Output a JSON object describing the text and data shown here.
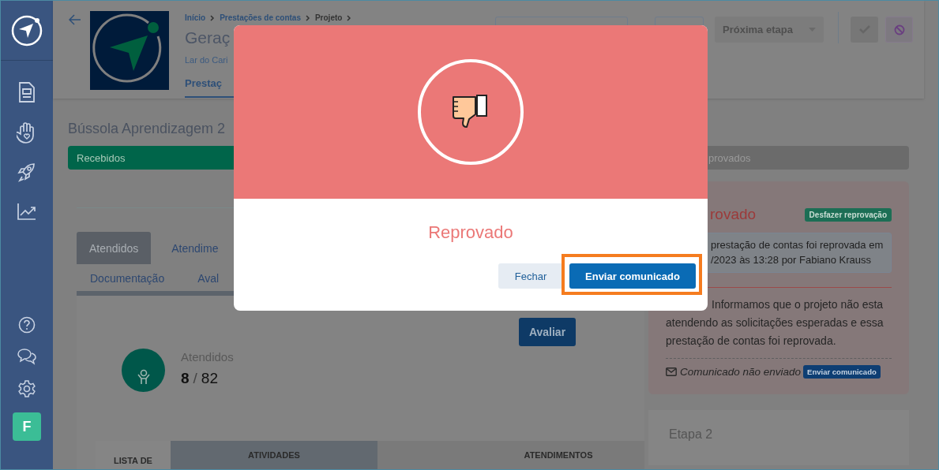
{
  "sidebar": {
    "avatar": "F"
  },
  "header": {
    "breadcrumb": [
      "Início",
      "Prestações de contas",
      "Projeto"
    ],
    "title": "Geraç",
    "subtitle": "Lar do Cari",
    "tab": {
      "label": "Prestaç",
      "selected": true
    },
    "next_button": "Próxima etapa"
  },
  "project_title": "Bússola Aprendizagem 2",
  "stages": [
    {
      "label": "Recebidos",
      "color": "#00654a"
    },
    {
      "label": "provados",
      "color": "#6b6b6b"
    }
  ],
  "tabs": [
    {
      "label": "Atendidos",
      "selected": true
    },
    {
      "label": "Atendime",
      "selected": false
    }
  ],
  "subtabs": [
    "Documentação",
    "Aval"
  ],
  "panel": {
    "button": "Avaliar",
    "stat": {
      "label": "Atendidos",
      "value": "8",
      "separator": "/",
      "total": "82"
    },
    "columns": [
      "LISTA DE",
      "ATIVIDADES",
      "ATENDIMENTOS"
    ]
  },
  "review": {
    "status": "rovado",
    "undo_button": "Desfazer reprovação",
    "notice": [
      "prestação de contas foi reprovada em",
      "/2023 às 13:28 por Fabiano Krauss"
    ],
    "opinion": "Informamos que o projeto não esta atendendo as solicitações esperadas e essa prestação de contas foi reprovada.",
    "message_status": "Comunicado não enviado",
    "send_button": "Enviar comunicado"
  },
  "next_step": "Etapa 2",
  "modal": {
    "title": "Reprovado",
    "buttons": [
      {
        "label": "Fechar",
        "kind": "secondary",
        "highlighted": false
      },
      {
        "label": "Enviar comunicado",
        "kind": "primary",
        "highlighted": true
      }
    ]
  }
}
